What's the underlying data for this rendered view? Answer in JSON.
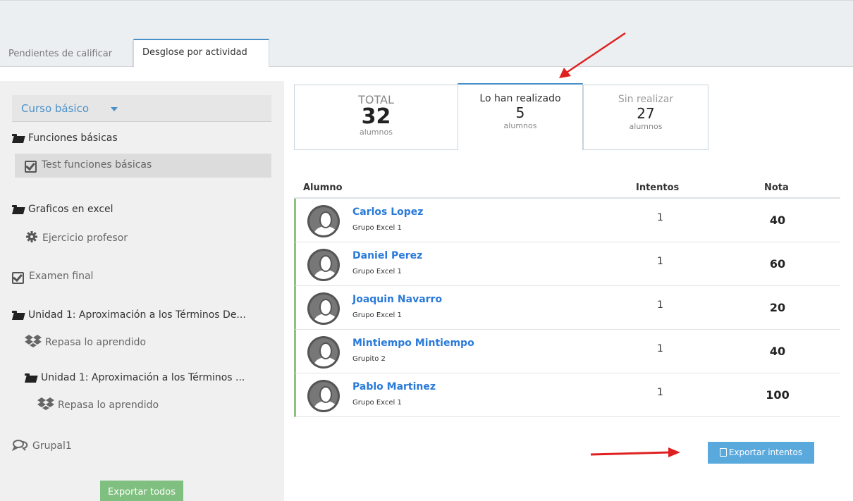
{
  "tabs": [
    {
      "label": "Pendientes de calificar"
    },
    {
      "label": "Desglose por actividad"
    }
  ],
  "sidebar": {
    "course": "Curso básico",
    "items": [
      {
        "label": "Funciones básicas"
      },
      {
        "label": "Test funciones básicas"
      },
      {
        "label": "Graficos en excel"
      },
      {
        "label": "Ejercicio profesor"
      },
      {
        "label": "Examen final"
      },
      {
        "label": "Unidad 1: Aproximación a los Términos De..."
      },
      {
        "label": "Repasa lo aprendido"
      },
      {
        "label": "Unidad 1: Aproximación a los Términos ..."
      },
      {
        "label": "Repasa lo aprendido"
      },
      {
        "label": "Grupal1"
      }
    ],
    "export_all": "Exportar todos"
  },
  "stats": {
    "total": {
      "label": "TOTAL",
      "value": "32",
      "unit": "alumnos"
    },
    "done": {
      "label": "Lo han realizado",
      "value": "5",
      "unit": "alumnos"
    },
    "pending": {
      "label": "Sin realizar",
      "value": "27",
      "unit": "alumnos"
    }
  },
  "table": {
    "headers": {
      "student": "Alumno",
      "attempts": "Intentos",
      "grade": "Nota"
    },
    "rows": [
      {
        "name": "Carlos Lopez",
        "group": "Grupo Excel 1",
        "attempts": "1",
        "grade": "40"
      },
      {
        "name": "Daniel Perez",
        "group": "Grupo Excel 1",
        "attempts": "1",
        "grade": "60"
      },
      {
        "name": "Joaquin Navarro",
        "group": "Grupo Excel 1",
        "attempts": "1",
        "grade": "20"
      },
      {
        "name": "Mintiempo Mintiempo",
        "group": "Grupito 2",
        "attempts": "1",
        "grade": "40"
      },
      {
        "name": "Pablo Martinez",
        "group": "Grupo Excel 1",
        "attempts": "1",
        "grade": "100"
      }
    ]
  },
  "export_attempts": "Exportar intentos",
  "colors": {
    "accent": "#4a90c8",
    "link": "#2a7ad9",
    "row_marker": "#8ec07e",
    "annotation": "#e02020"
  }
}
